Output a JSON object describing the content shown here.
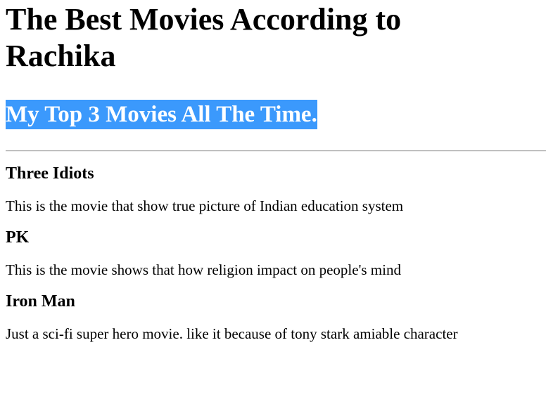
{
  "page": {
    "title": "The Best Movies According to Rachika",
    "subtitle": "My Top 3 Movies All The Time."
  },
  "movies": [
    {
      "name": "Three Idiots",
      "description": "This is the movie that show true picture of Indian education system"
    },
    {
      "name": "PK",
      "description": "This is the movie shows that how religion impact on people's mind"
    },
    {
      "name": "Iron Man",
      "description": "Just a sci-fi super hero movie. like it because of tony stark amiable character"
    }
  ],
  "colors": {
    "highlight_background": "#3b99fc",
    "highlight_text": "#ffffff"
  }
}
